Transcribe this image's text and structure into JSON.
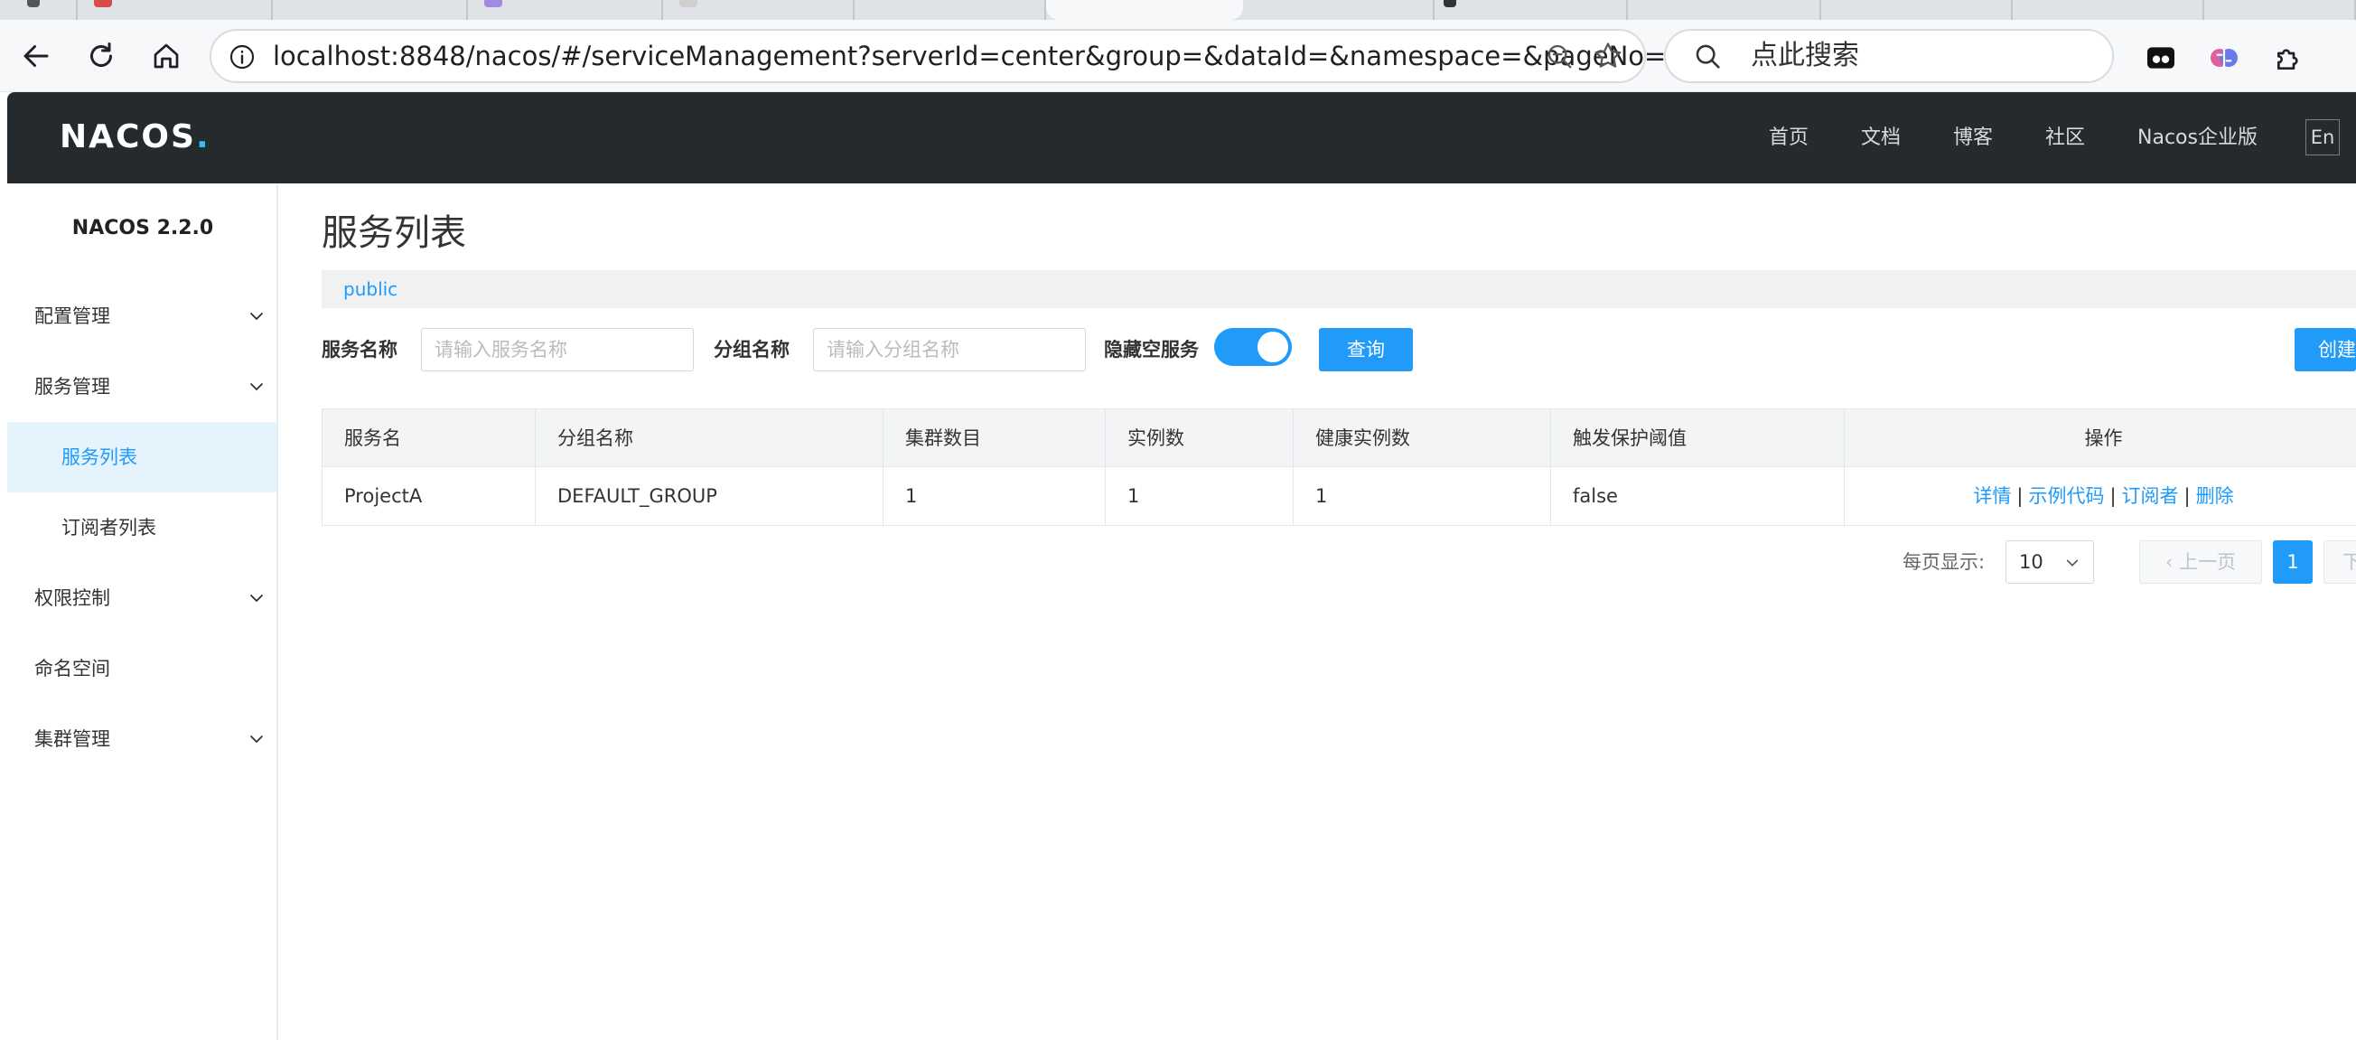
{
  "browser": {
    "url": "localhost:8848/nacos/#/serviceManagement?serverId=center&group=&dataId=&namespace=&pageNo=&pa...",
    "search_placeholder": "点此搜索"
  },
  "header": {
    "logo": "NACOS",
    "nav": [
      "首页",
      "文档",
      "博客",
      "社区",
      "Nacos企业版"
    ],
    "lang": "En"
  },
  "sidebar": {
    "version": "NACOS 2.2.0",
    "items": [
      {
        "label": "配置管理"
      },
      {
        "label": "服务管理"
      },
      {
        "label": "服务列表"
      },
      {
        "label": "订阅者列表"
      },
      {
        "label": "权限控制"
      },
      {
        "label": "命名空间"
      },
      {
        "label": "集群管理"
      }
    ]
  },
  "main": {
    "title": "服务列表",
    "namespace": "public",
    "filters": {
      "service_name_label": "服务名称",
      "service_name_placeholder": "请输入服务名称",
      "group_name_label": "分组名称",
      "group_name_placeholder": "请输入分组名称",
      "hide_empty_label": "隐藏空服务",
      "hide_empty_on": true,
      "query_button": "查询",
      "create_button": "创建服务"
    },
    "table": {
      "columns": [
        "服务名",
        "分组名称",
        "集群数目",
        "实例数",
        "健康实例数",
        "触发保护阈值",
        "操作"
      ],
      "rows": [
        [
          "ProjectA",
          "DEFAULT_GROUP",
          "1",
          "1",
          "1",
          "false"
        ]
      ],
      "actions": [
        "详情",
        "示例代码",
        "订阅者",
        "删除"
      ],
      "action_separator": "|"
    },
    "pagination": {
      "page_size_label": "每页显示:",
      "page_size": "10",
      "prev": "上一页",
      "current_page": "1",
      "next": "下一页"
    }
  },
  "colors": {
    "primary": "#209bfa",
    "header_bg": "#252a2f",
    "active_menu_bg": "#e5f3fd"
  }
}
